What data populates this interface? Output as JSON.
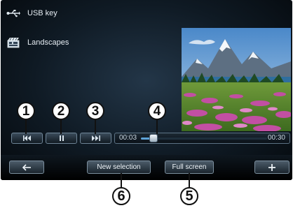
{
  "source": {
    "label": "USB key",
    "icon": "usb-icon"
  },
  "media_folder": {
    "label": "Landscapes",
    "icon": "film-icon"
  },
  "preview": {
    "icon": "landscape-photo"
  },
  "controls": {
    "previous_icon": "skip-previous-icon",
    "pause_icon": "pause-icon",
    "next_icon": "skip-next-icon"
  },
  "progress": {
    "elapsed": "00:03",
    "total": "00:30",
    "fraction": 0.1
  },
  "bottom_bar": {
    "back_icon": "back-arrow-icon",
    "new_selection_label": "New selection",
    "full_screen_label": "Full screen",
    "add_icon": "plus-icon"
  },
  "callouts": [
    "1",
    "2",
    "3",
    "4",
    "5",
    "6"
  ],
  "colors": {
    "accent": "#5ea4d8",
    "background": "#0f1a24"
  }
}
